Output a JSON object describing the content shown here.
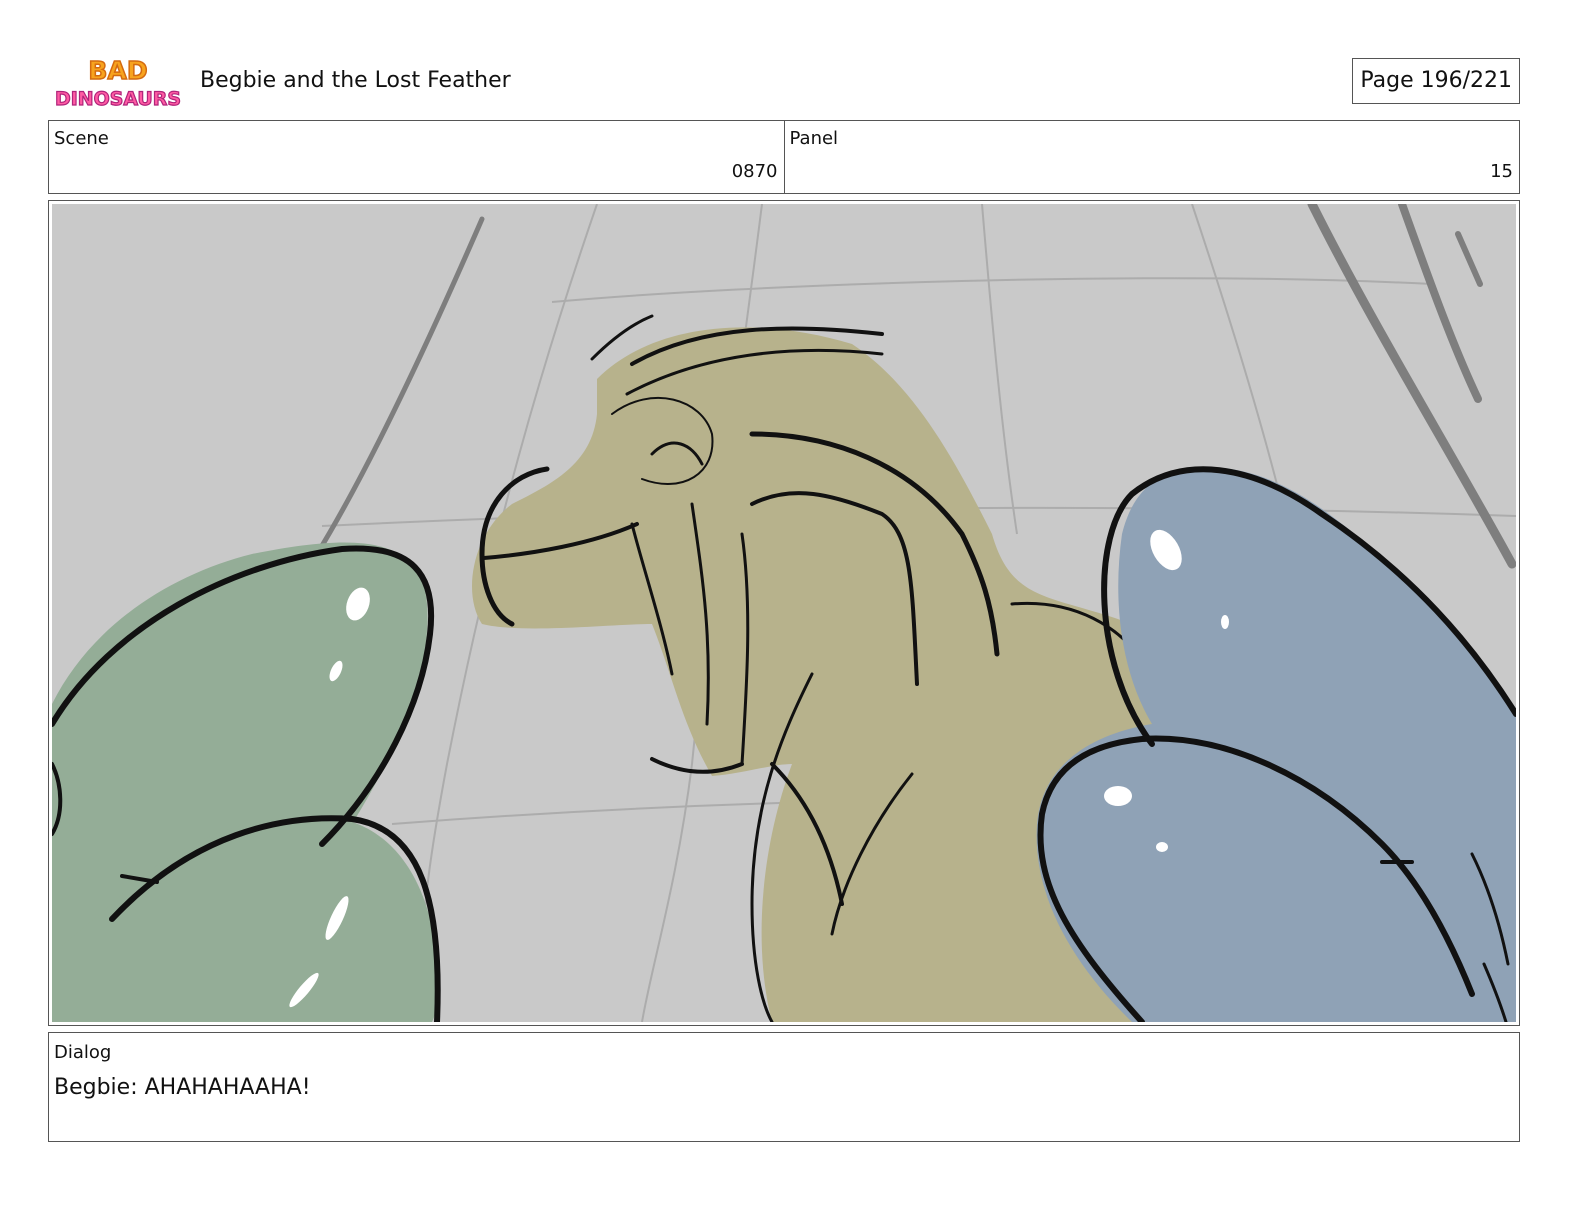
{
  "header": {
    "logo": {
      "icon": "bad-dinosaurs-logo",
      "line1": "BAD",
      "line2": "DINOSAURS"
    },
    "title": "Begbie and the Lost Feather",
    "page": "Page 196/221"
  },
  "scene": {
    "label": "Scene",
    "value": "0870"
  },
  "panel": {
    "label": "Panel",
    "value": "15"
  },
  "artwork": {
    "subject": "storyboard-sketch"
  },
  "dialog": {
    "label": "Dialog",
    "text": "Begbie: AHAHAHAAHA!"
  },
  "colors": {
    "background": "#c9c9c9",
    "green_dino": "#94ad97",
    "yellow_dino": "#b7b28c",
    "blue_dino": "#8fa2b6",
    "ink": "#111111"
  }
}
